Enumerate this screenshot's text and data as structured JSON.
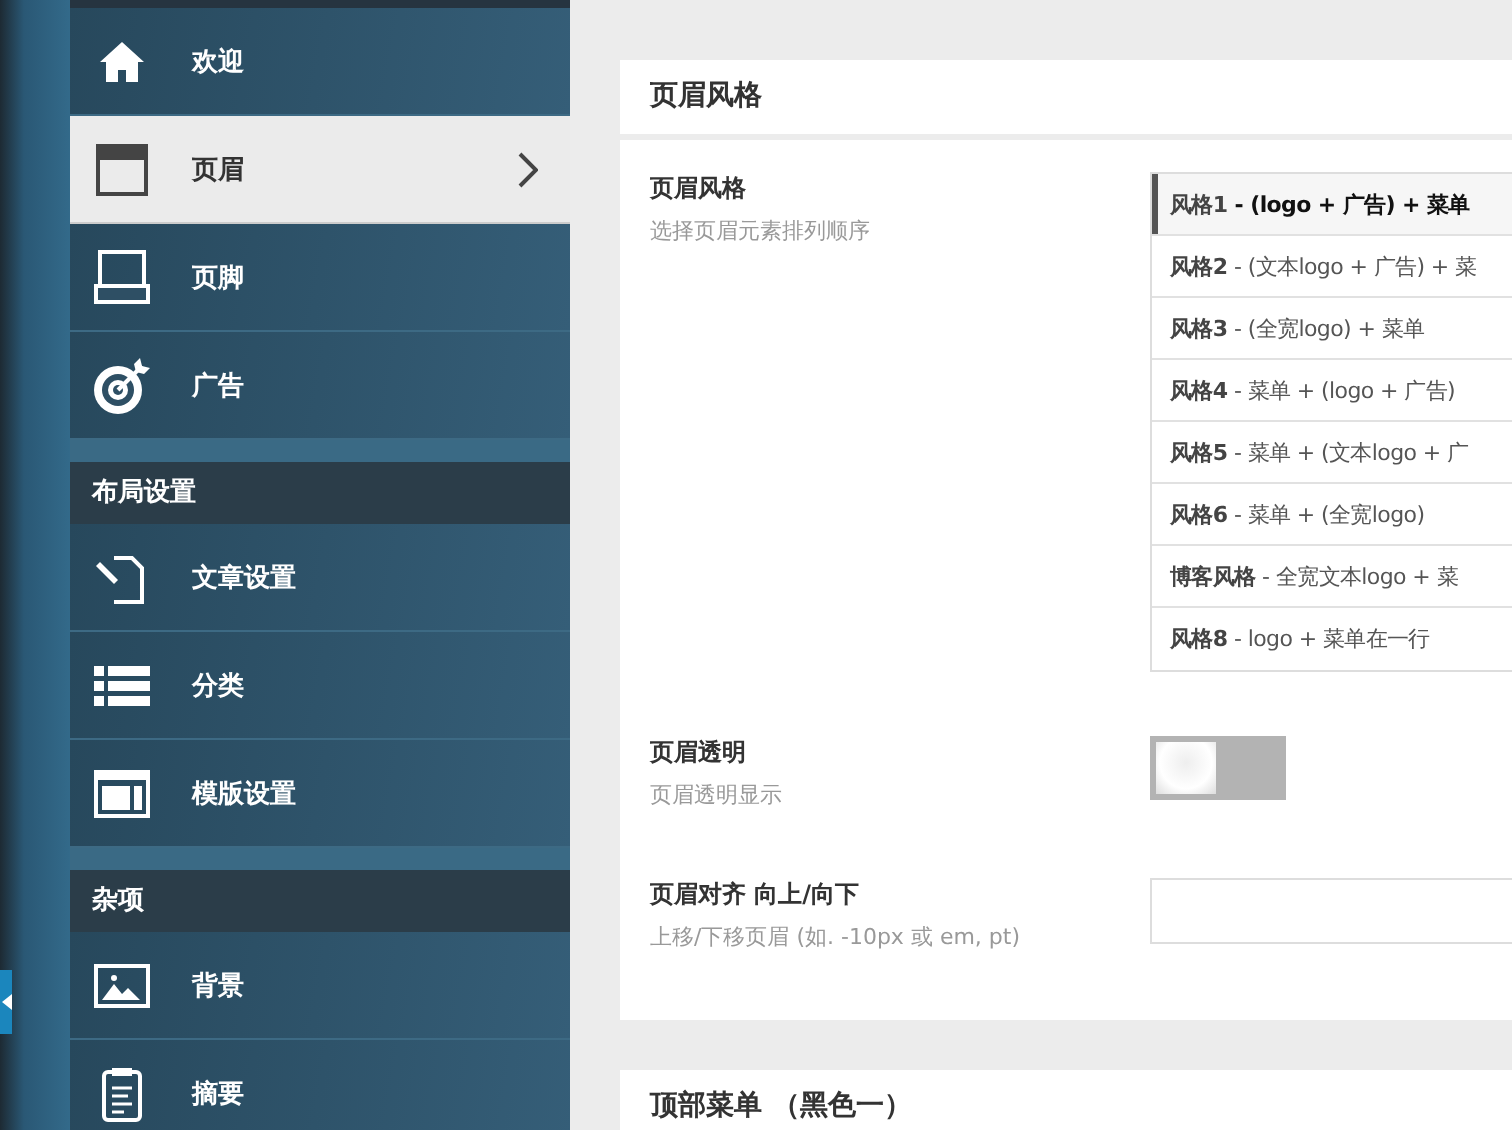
{
  "sidebar": {
    "sections": [
      {
        "items": [
          {
            "label": "欢迎",
            "selected": false
          },
          {
            "label": "页眉",
            "selected": true
          },
          {
            "label": "页脚",
            "selected": false
          },
          {
            "label": "广告",
            "selected": false
          }
        ]
      },
      {
        "title": "布局设置",
        "items": [
          {
            "label": "文章设置",
            "selected": false
          },
          {
            "label": "分类",
            "selected": false
          },
          {
            "label": "模版设置",
            "selected": false
          }
        ]
      },
      {
        "title": "杂项",
        "items": [
          {
            "label": "背景",
            "selected": false
          },
          {
            "label": "摘要",
            "selected": false
          }
        ]
      }
    ]
  },
  "panels": [
    {
      "title": "页眉风格",
      "fields": [
        {
          "kind": "choices",
          "label": "页眉风格",
          "description": "选择页眉元素排列顺序",
          "options": [
            {
              "text": "**风格1** - (logo + 广告) + 菜单",
              "selected": true
            },
            {
              "text": "**风格2** - (文本logo + 广告) + 菜",
              "selected": false
            },
            {
              "text": "**风格3** - (全宽logo) + 菜单",
              "selected": false
            },
            {
              "text": "**风格4** - 菜单 + (logo + 广告)",
              "selected": false
            },
            {
              "text": "**风格5** - 菜单 + (文本logo + 广",
              "selected": false
            },
            {
              "text": "**风格6** - 菜单 + (全宽logo)",
              "selected": false
            },
            {
              "text": "**博客风格** - 全宽文本logo + 菜",
              "selected": false
            },
            {
              "text": "**风格8** - logo + 菜单在一行",
              "selected": false
            }
          ]
        },
        {
          "kind": "toggle",
          "label": "页眉透明",
          "description": "页眉透明显示",
          "on": false
        },
        {
          "kind": "text",
          "label": "页眉对齐 向上/向下",
          "description": "上移/下移页眉 (如. -10px 或 em, pt)"
        }
      ]
    },
    {
      "title": "顶部菜单 （黑色一）"
    }
  ]
}
